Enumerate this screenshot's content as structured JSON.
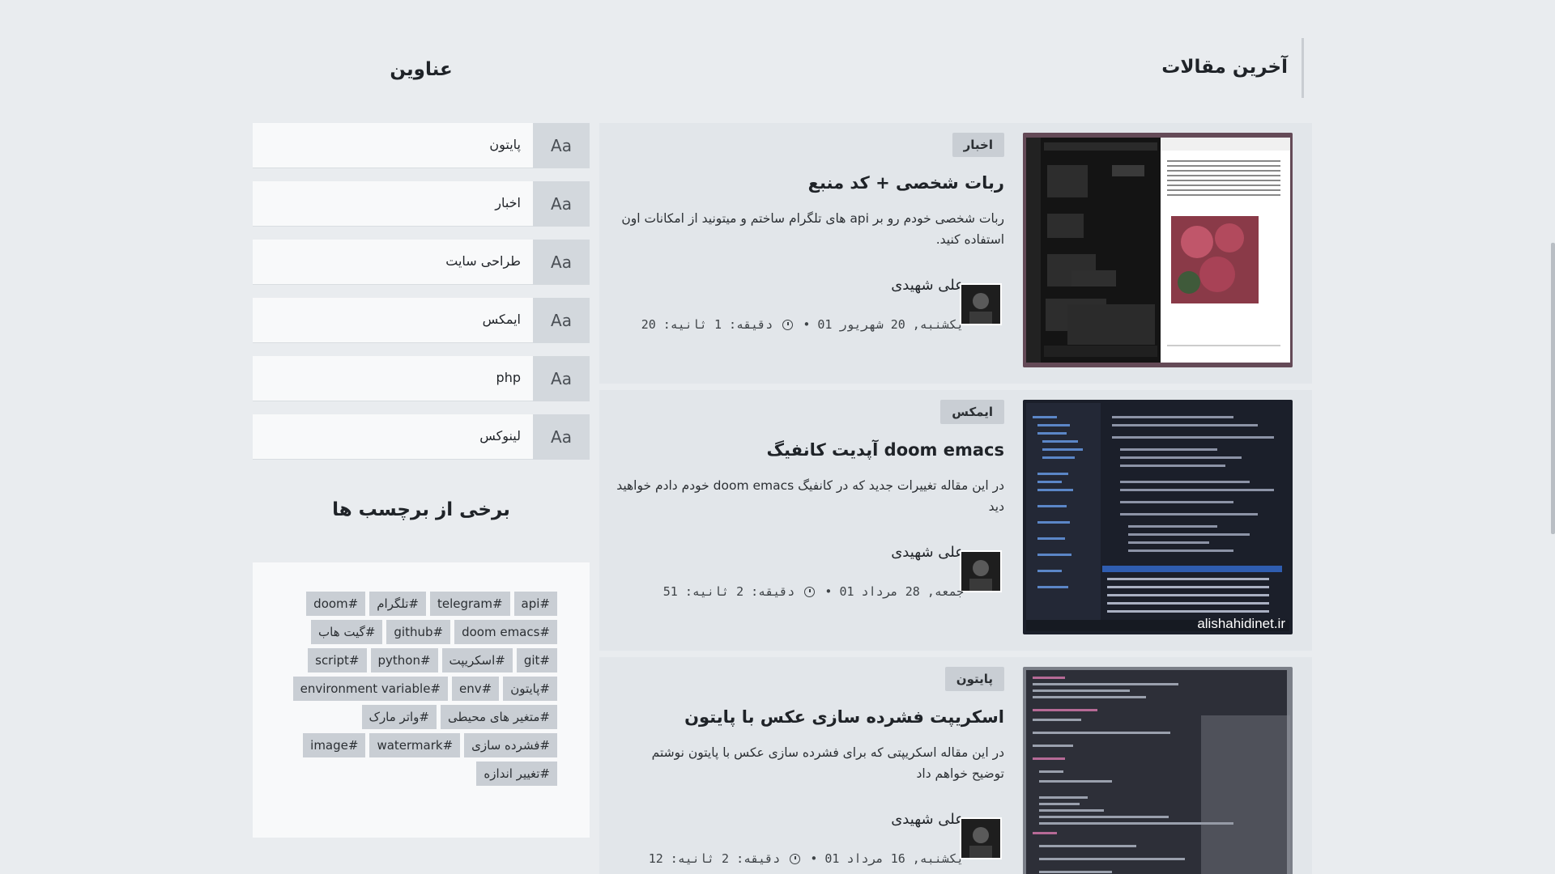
{
  "main": {
    "title": "آخرین مقالات",
    "posts": [
      {
        "category": "اخبار",
        "title": "ربات شخصی + کد منبع",
        "excerpt": "ربات شخصی خودم رو بر api های تلگرام ساختم و میتونید از امکانات اون استفاده کنید.",
        "author": "علی شهیدی",
        "date": "یکشنبه, 20 شهریور 01",
        "duration": "دقیقه: 1 ثانیه: 20",
        "thumb_label": ""
      },
      {
        "category": "ایمکس",
        "title": "آپدیت کانفیگ doom emacs",
        "excerpt": "در این مقاله تغییرات جدید که در کانفیگ doom emacs خودم دادم خواهید دید",
        "author": "علی شهیدی",
        "date": "جمعه, 28 مرداد 01",
        "duration": "دقیقه: 2 ثانیه: 51",
        "thumb_label": "alishahidinet.ir"
      },
      {
        "category": "پایتون",
        "title": "اسکریپت فشرده سازی عکس با پایتون",
        "excerpt": "در این مقاله اسکریپتی که برای فشرده سازی عکس با پایتون نوشتم توضیح خواهم داد",
        "author": "علی شهیدی",
        "date": "یکشنبه, 16 مرداد 01",
        "duration": "دقیقه: 2 ثانیه: 12",
        "thumb_label": ""
      }
    ]
  },
  "sidebar": {
    "categories_title": "عناوین",
    "categories": [
      {
        "icon": "Aa",
        "label": "پایتون"
      },
      {
        "icon": "Aa",
        "label": "اخبار"
      },
      {
        "icon": "Aa",
        "label": "طراحی سایت"
      },
      {
        "icon": "Aa",
        "label": "ایمکس"
      },
      {
        "icon": "Aa",
        "label": "php"
      },
      {
        "icon": "Aa",
        "label": "لینوکس"
      }
    ],
    "tags_title": "برخی از برچسب ها",
    "tags": [
      "api#",
      "telegram#",
      "تلگرام#",
      "doom#",
      "doom emacs#",
      "github#",
      "گیت هاب#",
      "git#",
      "اسکریپت#",
      "python#",
      "script#",
      "پایتون#",
      "env#",
      "environment variable#",
      "متغیر های محیطی#",
      "واتر مارک#",
      "فشرده سازی#",
      "watermark#",
      "image#",
      "تغییر اندازه#"
    ]
  },
  "colors": {
    "background": "#e9ecef",
    "card": "#e2e6ea",
    "tag": "#c9ced4",
    "sidebar_card": "#f8f9fa"
  }
}
